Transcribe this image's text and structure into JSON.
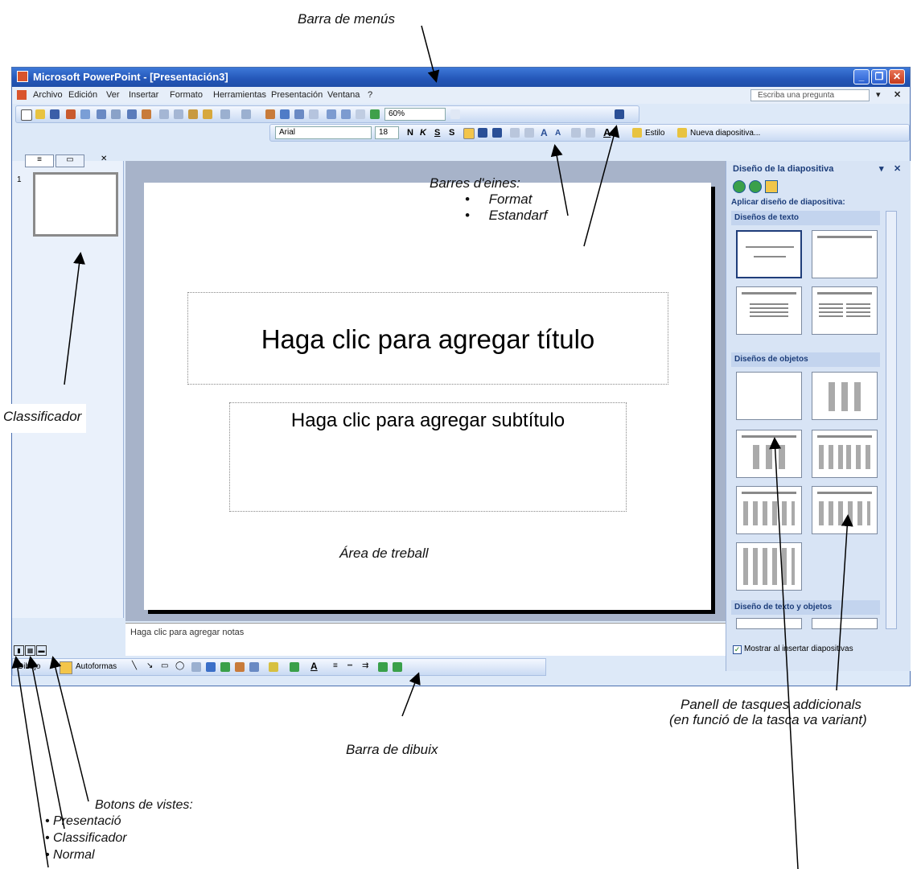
{
  "annotations": {
    "menu_bar": "Barra de menús",
    "toolbars_title": "Barres d'eines:",
    "toolbars_items": [
      "Format",
      "Estandarf"
    ],
    "sorter": "Classificador",
    "work_area": "Área de treball",
    "task_panel_line1": "Panell de tasques addicionals",
    "task_panel_line2": "(en funció de la tasca va variant)",
    "drawing_bar": "Barra de dibuix",
    "view_buttons_title": "Botons de vistes:",
    "view_buttons": [
      "Presentació",
      "Classificador",
      "Normal"
    ]
  },
  "window": {
    "title": "Microsoft PowerPoint - [Presentación3]",
    "controls": [
      "_",
      "❐",
      "✕"
    ]
  },
  "menu": {
    "items": [
      "Archivo",
      "Edición",
      "Ver",
      "Insertar",
      "Formato",
      "Herramientas",
      "Presentación",
      "Ventana",
      "?"
    ],
    "ask_placeholder": "Escriba una pregunta"
  },
  "standard_toolbar": {
    "zoom": "60%"
  },
  "format_toolbar": {
    "font": "Arial",
    "size": "18",
    "bold": "N",
    "italic": "K",
    "underline": "S",
    "shadow": "S",
    "style_btn": "Estilo",
    "new_slide_btn": "Nueva diapositiva..."
  },
  "slides_pane": {
    "slide_number": "1"
  },
  "slide": {
    "title_placeholder": "Haga clic para agregar título",
    "subtitle_placeholder": "Haga clic para agregar subtítulo"
  },
  "notes": {
    "placeholder": "Haga clic para agregar notas"
  },
  "task_pane": {
    "title": "Diseño de la diapositiva",
    "apply_label": "Aplicar diseño de diapositiva:",
    "section_text": "Diseños de texto",
    "section_objects": "Diseños de objetos",
    "section_text_objects": "Diseño de texto y objetos",
    "show_checkbox": "Mostrar al insertar diapositivas"
  },
  "drawing_toolbar": {
    "draw_label": "Dibujo",
    "autoshapes_label": "Autoformas"
  },
  "colors": {
    "title_bar": "#2456b8",
    "slide_bg": "#ffffff",
    "workspace": "#a7b3c9"
  }
}
